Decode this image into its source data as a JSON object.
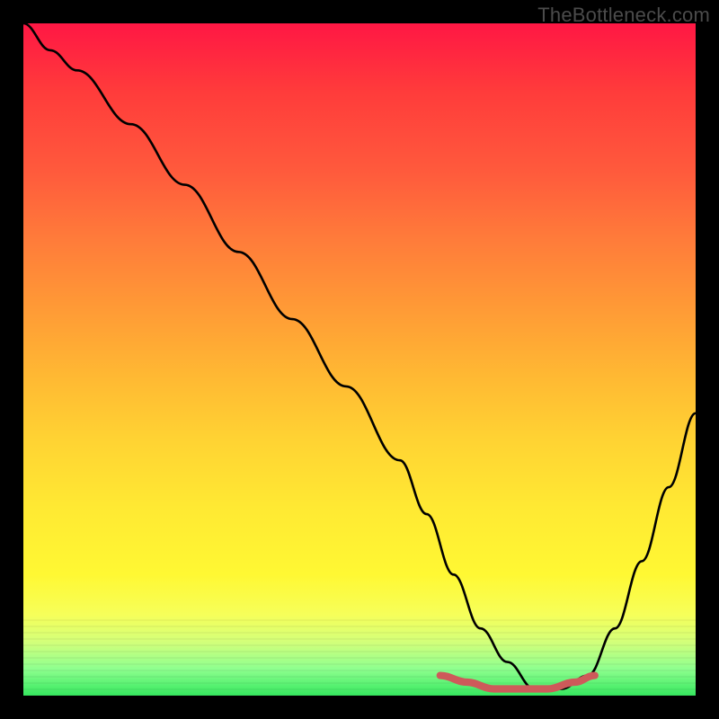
{
  "watermark": "TheBottleneck.com",
  "chart_data": {
    "type": "line",
    "title": "",
    "xlabel": "",
    "ylabel": "",
    "xlim": [
      0,
      100
    ],
    "ylim": [
      0,
      100
    ],
    "grid": false,
    "legend": false,
    "series": [
      {
        "name": "black-curve",
        "color": "#000000",
        "x": [
          0,
          4,
          8,
          16,
          24,
          32,
          40,
          48,
          56,
          60,
          64,
          68,
          72,
          76,
          80,
          84,
          88,
          92,
          96,
          100
        ],
        "values": [
          100,
          96,
          93,
          85,
          76,
          66,
          56,
          46,
          35,
          27,
          18,
          10,
          5,
          1,
          1,
          3,
          10,
          20,
          31,
          42
        ]
      },
      {
        "name": "red-highlight",
        "color": "#d05454",
        "x": [
          62,
          66,
          70,
          74,
          78,
          82,
          85
        ],
        "values": [
          3,
          2,
          1,
          1,
          1,
          2,
          3
        ]
      }
    ],
    "annotations": [
      {
        "text": "TheBottleneck.com",
        "pos": "top-right"
      }
    ]
  }
}
